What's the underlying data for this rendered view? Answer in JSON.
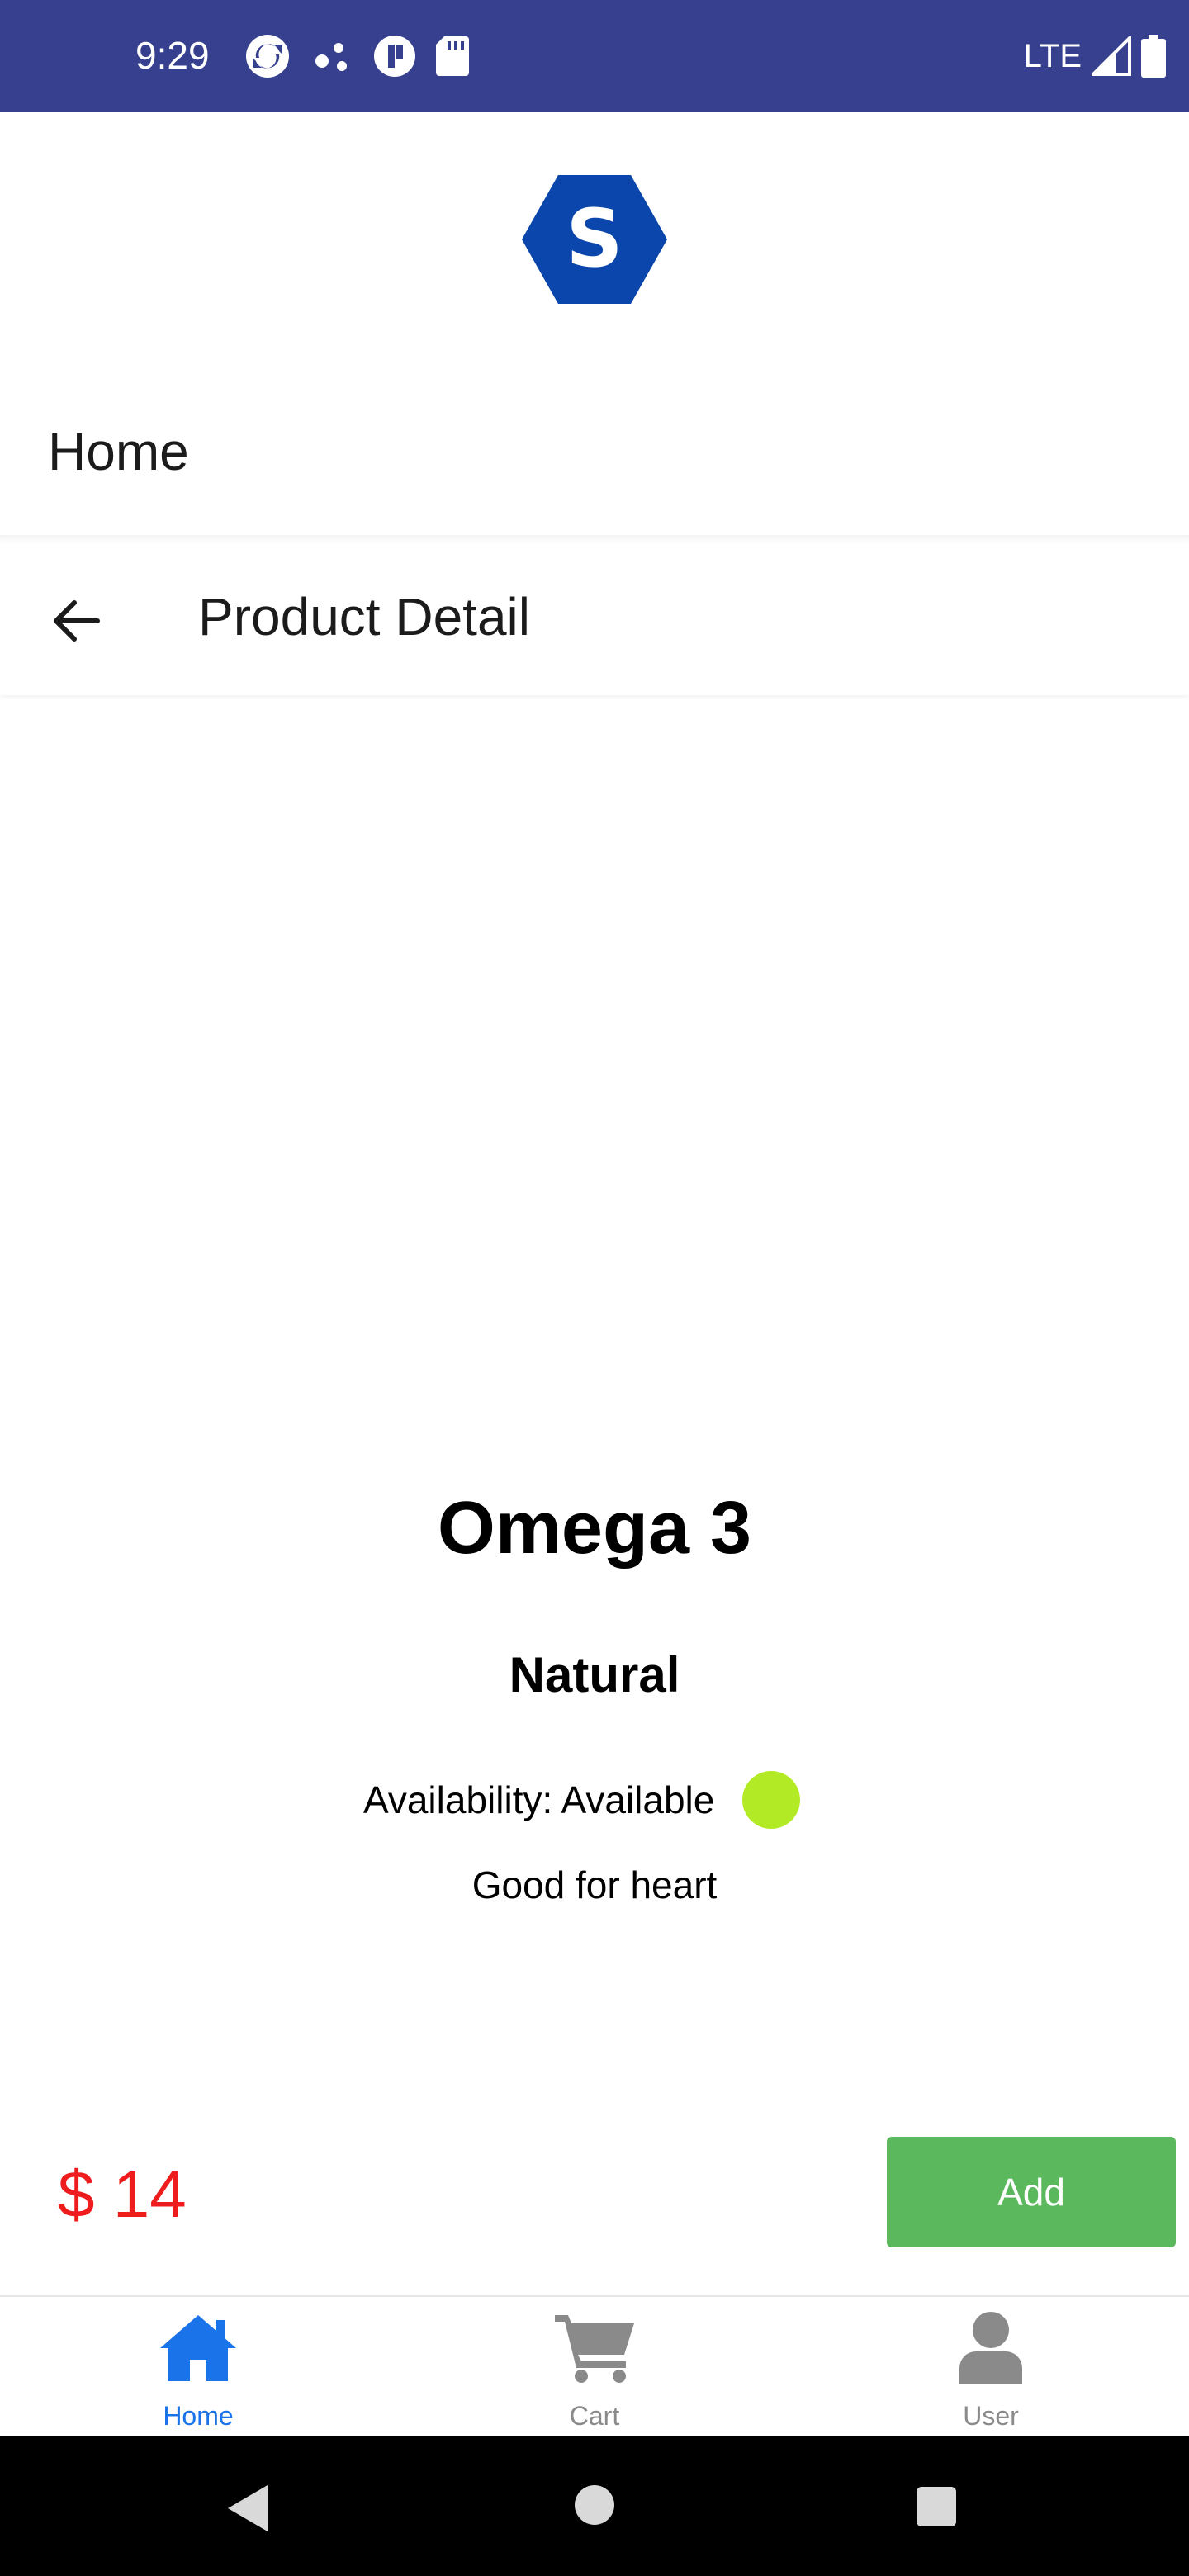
{
  "status_bar": {
    "time": "9:29",
    "network": "LTE",
    "left_icons": [
      "sync-icon",
      "settings-dots-icon",
      "app-badge-icon",
      "sd-card-icon"
    ],
    "right_icons": [
      "signal-icon",
      "battery-icon"
    ]
  },
  "app": {
    "logo_letter": "S",
    "logo_color": "#0b46ad",
    "header_title": "Home"
  },
  "navbar": {
    "back_icon": "arrow-left-icon",
    "title": "Product Detail"
  },
  "product": {
    "name": "Omega 3",
    "category": "Natural",
    "availability_text": "Availability: Available",
    "availability_color": "#b3ea26",
    "description": "Good for heart",
    "price": "$ 14",
    "price_color": "#ee1c1c",
    "add_label": "Add",
    "add_color": "#5cb85c"
  },
  "tabbar": {
    "items": [
      {
        "label": "Home",
        "icon": "home-icon",
        "active": true,
        "color": "#1a73e8"
      },
      {
        "label": "Cart",
        "icon": "cart-icon",
        "active": false,
        "color": "#8a8a8a"
      },
      {
        "label": "User",
        "icon": "user-icon",
        "active": false,
        "color": "#8a8a8a"
      }
    ]
  },
  "system_nav": {
    "buttons": [
      "back-triangle-icon",
      "home-circle-icon",
      "recents-square-icon"
    ]
  }
}
